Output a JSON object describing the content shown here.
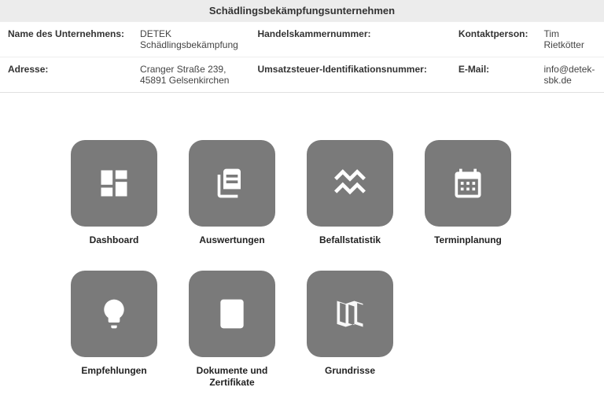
{
  "header": {
    "title": "Schädlingsbekämpfungsunternehmen",
    "fields": {
      "company_label": "Name des Unternehmens:",
      "company_value": "DETEK Schädlingsbekämpfung",
      "chamber_label": "Handelskammernummer:",
      "chamber_value": "",
      "contact_label": "Kontaktperson:",
      "contact_value": "Tim Rietkötter",
      "address_label": "Adresse:",
      "address_value": "Cranger Straße 239, 45891 Gelsenkirchen",
      "vat_label": "Umsatzsteuer-Identifikationsnummer:",
      "vat_value": "",
      "email_label": "E-Mail:",
      "email_value": "info@detek-sbk.de"
    }
  },
  "tiles": [
    {
      "label": "Dashboard"
    },
    {
      "label": "Auswertungen"
    },
    {
      "label": "Befallstatistik"
    },
    {
      "label": "Terminplanung"
    },
    {
      "label": "Empfehlungen"
    },
    {
      "label": "Dokumente und Zertifikate"
    },
    {
      "label": "Grundrisse"
    }
  ]
}
